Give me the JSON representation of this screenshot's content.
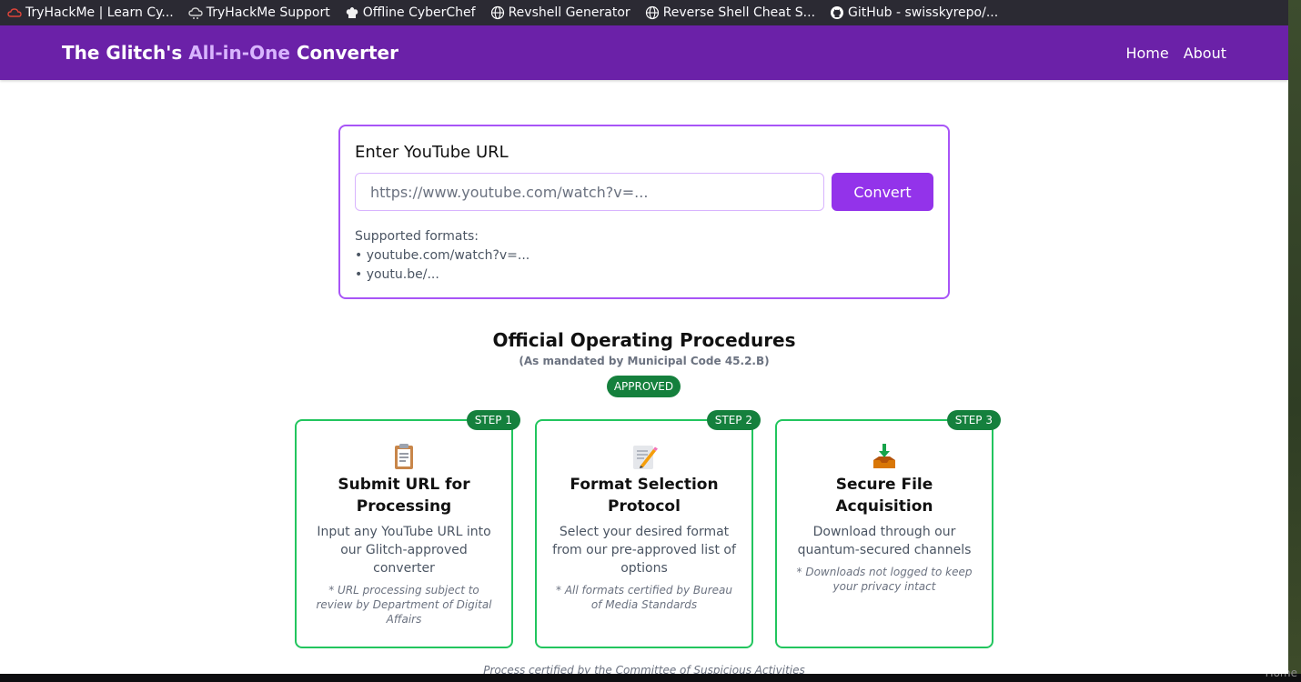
{
  "bookmarks": [
    {
      "label": "TryHackMe | Learn Cy...",
      "icon": "tryhackme-cloud-icon",
      "color": "#e0453a"
    },
    {
      "label": "TryHackMe Support",
      "icon": "support-cloud-icon",
      "color": "#d0d0d0"
    },
    {
      "label": "Offline CyberChef",
      "icon": "chef-hat-icon",
      "color": "#ffffff"
    },
    {
      "label": "Revshell Generator",
      "icon": "globe-icon",
      "color": "#ffffff"
    },
    {
      "label": "Reverse Shell Cheat S...",
      "icon": "globe-icon",
      "color": "#ffffff"
    },
    {
      "label": "GitHub - swisskyrepo/...",
      "icon": "github-icon",
      "color": "#ffffff"
    }
  ],
  "navbar": {
    "brand_prefix": "The Glitch's ",
    "brand_highlight": "All-in-One",
    "brand_suffix": " Converter",
    "links": [
      "Home",
      "About"
    ]
  },
  "converter": {
    "title": "Enter YouTube URL",
    "placeholder": "https://www.youtube.com/watch?v=...",
    "button": "Convert",
    "formats_heading": "Supported formats:",
    "formats": [
      "• youtube.com/watch?v=...",
      "• youtu.be/..."
    ]
  },
  "procedures": {
    "title": "Official Operating Procedures",
    "subtitle": "(As mandated by Municipal Code 45.2.B)",
    "badge": "APPROVED",
    "steps": [
      {
        "badge": "STEP 1",
        "icon": "clipboard-icon",
        "title": "Submit URL for Processing",
        "desc": "Input any YouTube URL into our Glitch-approved converter",
        "note": "* URL processing subject to review by Department of Digital Affairs"
      },
      {
        "badge": "STEP 2",
        "icon": "memo-icon",
        "title": "Format Selection Protocol",
        "desc": "Select your desired format from our pre-approved list of options",
        "note": "* All formats certified by Bureau of Media Standards"
      },
      {
        "badge": "STEP 3",
        "icon": "inbox-download-icon",
        "title": "Secure File Acquisition",
        "desc": "Download through our quantum-secured channels",
        "note": "* Downloads not logged to keep your privacy intact"
      }
    ],
    "footer": "Process certified by the Committee of Suspicious Activities"
  },
  "ghost_text": "Home",
  "colors": {
    "navbar": "#6b21a8",
    "accent": "#9333ea",
    "approved": "#15803d",
    "step_border": "#22c55e"
  }
}
